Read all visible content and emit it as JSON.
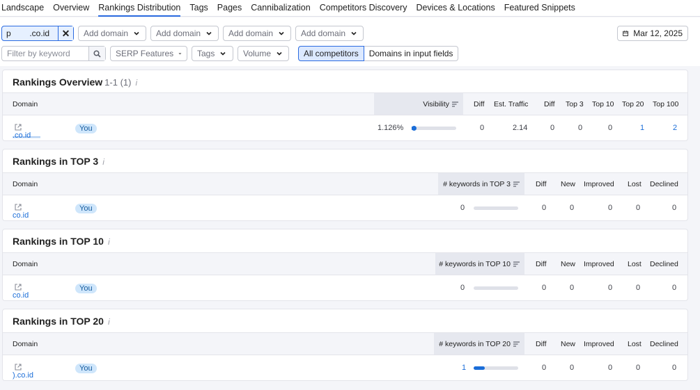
{
  "tabs": [
    "Landscape",
    "Overview",
    "Rankings Distribution",
    "Tags",
    "Pages",
    "Cannibalization",
    "Competitors Discovery",
    "Devices & Locations",
    "Featured Snippets"
  ],
  "active_tab": "Rankings Distribution",
  "filters": {
    "domain_chip": "p        .co.id",
    "add_domain": "Add domain",
    "date": "Mar 12, 2025",
    "keyword_placeholder": "Filter by keyword",
    "serp": "SERP Features",
    "tags": "Tags",
    "volume": "Volume",
    "all_competitors": "All competitors",
    "domains_input": "Domains in input fields"
  },
  "overview": {
    "title": "Rankings Overview",
    "count": "1-1 (1)",
    "headers": {
      "domain": "Domain",
      "visibility": "Visibility",
      "diff": "Diff",
      "traffic": "Est. Traffic",
      "diff2": "Diff",
      "top3": "Top 3",
      "top10": "Top 10",
      "top20": "Top 20",
      "top100": "Top 100"
    },
    "row": {
      "domain": ".co.id",
      "you": "You",
      "visibility": "1.126%",
      "visibility_fraction": 0.02,
      "diff": "0",
      "traffic": "2.14",
      "diff2": "0",
      "top3": "0",
      "top10": "0",
      "top20": "1",
      "top100": "2"
    }
  },
  "top3": {
    "title": "Rankings in TOP 3",
    "headers": {
      "domain": "Domain",
      "kw": "# keywords in TOP 3",
      "diff": "Diff",
      "new": "New",
      "improved": "Improved",
      "lost": "Lost",
      "declined": "Declined"
    },
    "row": {
      "domain": "co.id",
      "you": "You",
      "kw": "0",
      "kw_fraction": 0,
      "diff": "0",
      "new": "0",
      "improved": "0",
      "lost": "0",
      "declined": "0"
    }
  },
  "top10": {
    "title": "Rankings in TOP 10",
    "headers": {
      "domain": "Domain",
      "kw": "# keywords in TOP 10",
      "diff": "Diff",
      "new": "New",
      "improved": "Improved",
      "lost": "Lost",
      "declined": "Declined"
    },
    "row": {
      "domain": "co.id",
      "you": "You",
      "kw": "0",
      "kw_fraction": 0,
      "diff": "0",
      "new": "0",
      "improved": "0",
      "lost": "0",
      "declined": "0"
    }
  },
  "top20": {
    "title": "Rankings in TOP 20",
    "headers": {
      "domain": "Domain",
      "kw": "# keywords in TOP 20",
      "diff": "Diff",
      "new": "New",
      "improved": "Improved",
      "lost": "Lost",
      "declined": "Declined"
    },
    "row": {
      "domain": ").co.id",
      "you": "You",
      "kw": "1",
      "kw_fraction": 0.25,
      "diff": "0",
      "new": "0",
      "improved": "0",
      "lost": "0",
      "declined": "0"
    }
  }
}
